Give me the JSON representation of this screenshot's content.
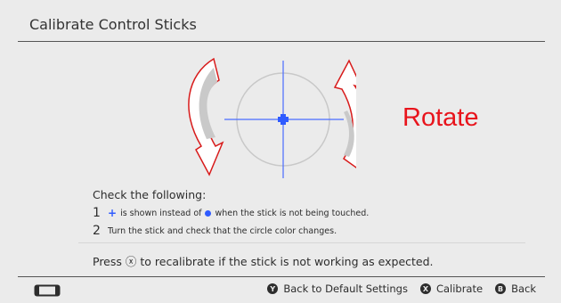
{
  "header": {
    "title": "Calibrate Control Sticks"
  },
  "diagram": {
    "rotate_label": "Rotate"
  },
  "instructions": {
    "heading": "Check the following:",
    "items": [
      {
        "num": "1",
        "before": "is shown instead of",
        "after": "when the stick is not being touched."
      },
      {
        "num": "2",
        "text": "Turn the stick and check that the circle color changes."
      }
    ],
    "press_before": "Press",
    "press_symbol": "ⓧ",
    "press_after": "to recalibrate if the stick is not working as expected."
  },
  "footer": {
    "buttons": [
      {
        "symbol": "Y",
        "label": "Back to Default Settings"
      },
      {
        "symbol": "X",
        "label": "Calibrate"
      },
      {
        "symbol": "B",
        "label": "Back"
      }
    ]
  },
  "colors": {
    "accent_blue": "#2f5bff",
    "annotation_red": "#e8141c"
  }
}
